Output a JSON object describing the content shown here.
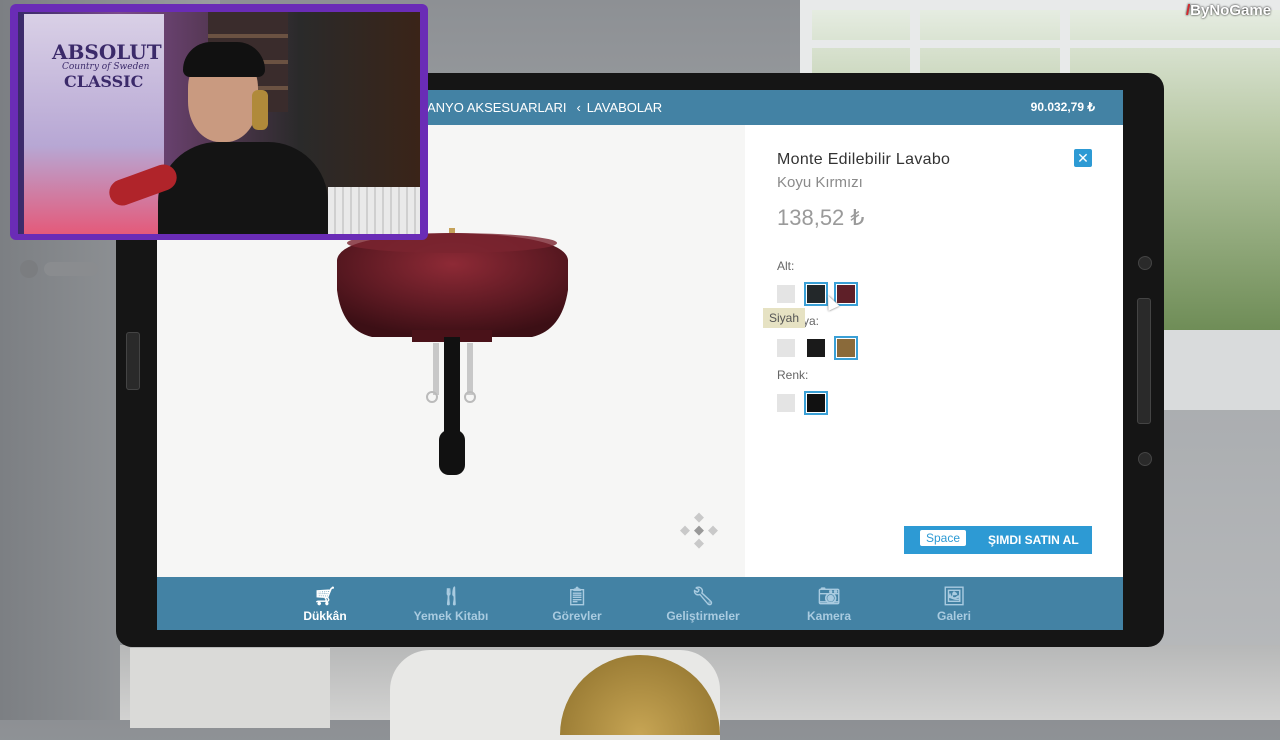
{
  "watermark": {
    "text": "ByNoGame"
  },
  "screen": {
    "breadcrumb": {
      "parent": "ANYO AKSESUARLARI",
      "separator": "‹",
      "current": "LAVABOLAR"
    },
    "balance": "90.032,79 ₺",
    "product": {
      "name": "Monte Edilebilir Lavabo",
      "variant": "Koyu Kırmızı",
      "price": "138,52 ₺"
    },
    "options": [
      {
        "label": "Alt:",
        "swatches": [
          {
            "color": "#e4e4e4"
          },
          {
            "color": "#23282a",
            "selected": true
          },
          {
            "color": "#5e1f28",
            "selected": true
          }
        ]
      },
      {
        "label": "ya:",
        "swatches": [
          {
            "color": "#e4e4e4"
          },
          {
            "color": "#1a1a1a"
          },
          {
            "color": "#8a6a3a",
            "selected": true
          }
        ]
      },
      {
        "label": "Renk:",
        "swatches": [
          {
            "color": "#e4e4e4"
          },
          {
            "color": "#111111",
            "selected": true
          }
        ]
      }
    ],
    "tooltip": "Siyah",
    "buy": {
      "key": "Space",
      "label": "ŞIMDI SATIN AL"
    },
    "nav": [
      {
        "label": "Dükkân",
        "icon": "cart-icon",
        "active": true
      },
      {
        "label": "Yemek Kitabı",
        "icon": "cutlery-icon"
      },
      {
        "label": "Görevler",
        "icon": "clipboard-icon"
      },
      {
        "label": "Geliştirmeler",
        "icon": "wrench-icon"
      },
      {
        "label": "Kamera",
        "icon": "camera-icon"
      },
      {
        "label": "Galeri",
        "icon": "image-icon"
      }
    ]
  },
  "webcam": {
    "poster": {
      "line1": "ABSOLUT",
      "line2": "Country of Sweden",
      "line3": "CLASSIC"
    }
  }
}
